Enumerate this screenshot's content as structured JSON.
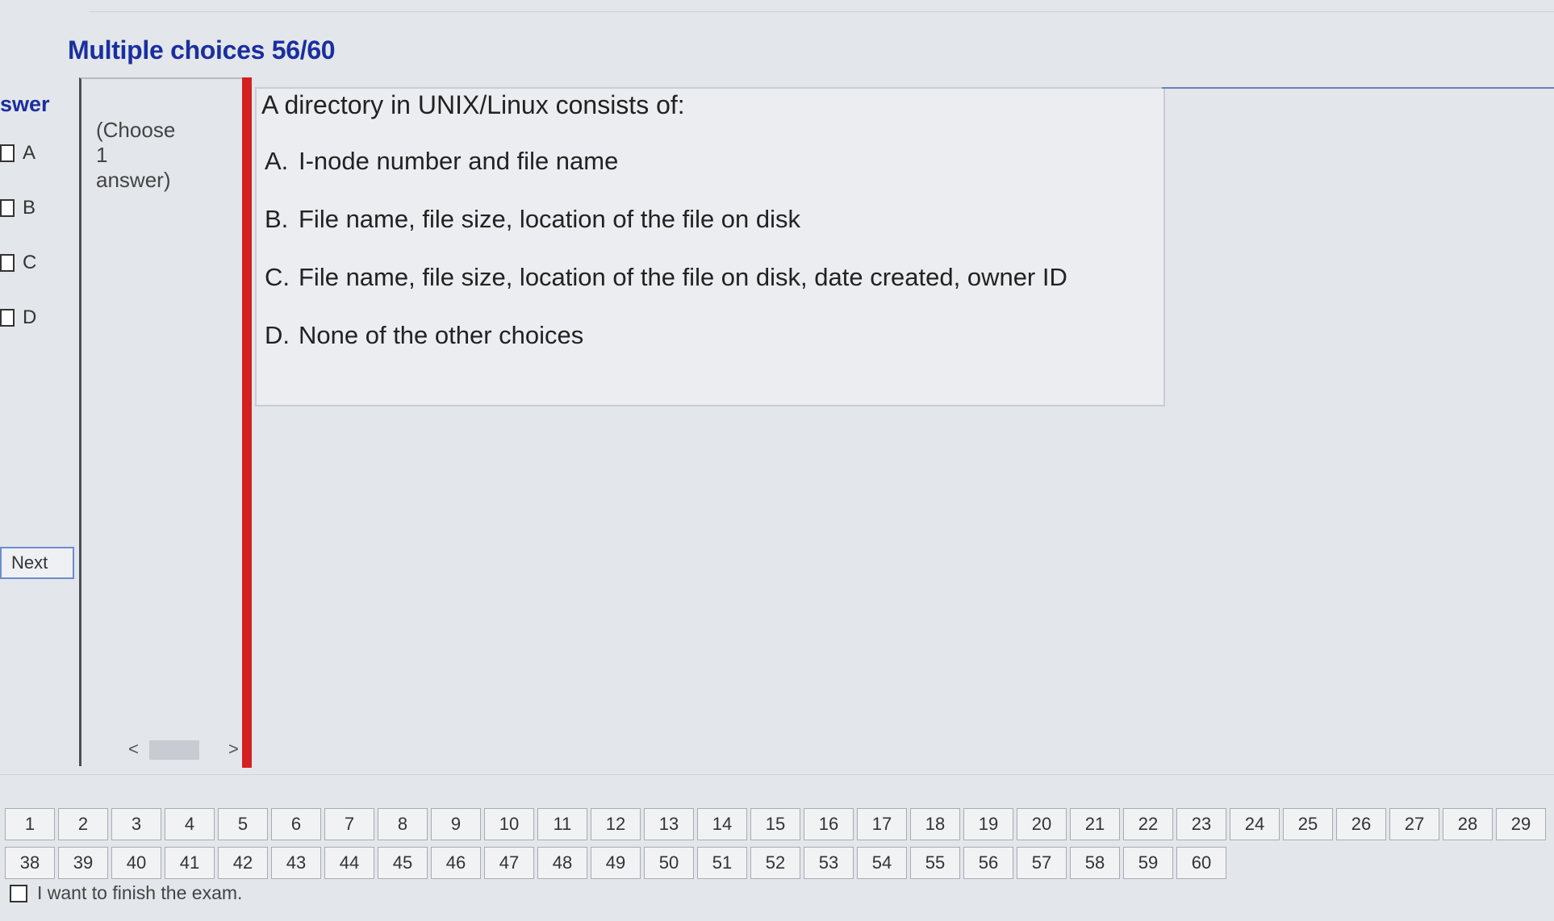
{
  "header": {
    "title": "Multiple choices 56/60"
  },
  "answer_panel": {
    "heading": "swer",
    "options": [
      {
        "letter": "A"
      },
      {
        "letter": "B"
      },
      {
        "letter": "C"
      },
      {
        "letter": "D"
      }
    ],
    "next_label": "Next"
  },
  "instruction": {
    "line1": "(Choose",
    "line2": "1",
    "line3": "answer)"
  },
  "scroll": {
    "left": "<",
    "right": ">"
  },
  "question": {
    "text": "A directory in UNIX/Linux consists of:",
    "choices": [
      {
        "letter": "A.",
        "text": "I-node number and file name"
      },
      {
        "letter": "B.",
        "text": "File name, file size, location of the file on disk"
      },
      {
        "letter": "C.",
        "text": "File name, file size, location of the file on disk, date created, owner ID"
      },
      {
        "letter": "D.",
        "text": "None of the other choices"
      }
    ]
  },
  "nav": {
    "row1": [
      "1",
      "2",
      "3",
      "4",
      "5",
      "6",
      "7",
      "8",
      "9",
      "10",
      "11",
      "12",
      "13",
      "14",
      "15",
      "16",
      "17",
      "18",
      "19",
      "20",
      "21",
      "22",
      "23",
      "24",
      "25",
      "26",
      "27",
      "28",
      "29"
    ],
    "row2": [
      "38",
      "39",
      "40",
      "41",
      "42",
      "43",
      "44",
      "45",
      "46",
      "47",
      "48",
      "49",
      "50",
      "51",
      "52",
      "53",
      "54",
      "55",
      "56",
      "57",
      "58",
      "59",
      "60"
    ]
  },
  "finish": {
    "label": "I want to finish the exam."
  }
}
